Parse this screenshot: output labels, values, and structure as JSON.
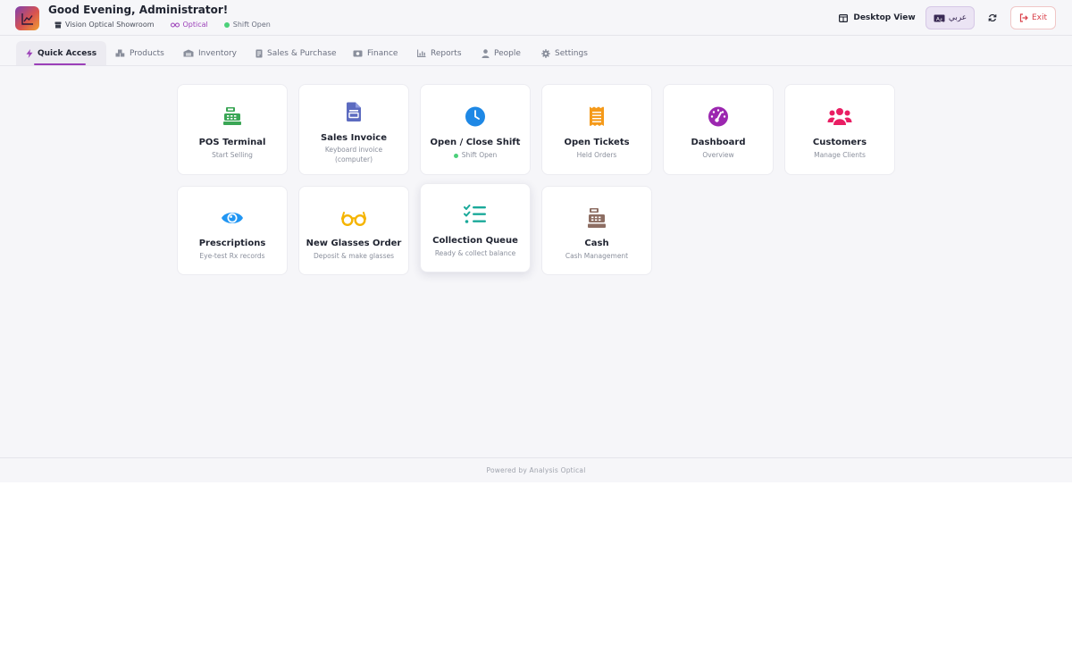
{
  "header": {
    "greeting": "Good Evening, Administrator!",
    "store": "Vision Optical Showroom",
    "mode": "Optical",
    "shift_status": "Shift Open",
    "desktop_view_label": "Desktop View",
    "language_label": "عربي",
    "exit_label": "Exit"
  },
  "tabs": [
    {
      "label": "Quick Access",
      "icon": "lightning-icon",
      "active": true
    },
    {
      "label": "Products",
      "icon": "boxes-icon"
    },
    {
      "label": "Inventory",
      "icon": "warehouse-icon"
    },
    {
      "label": "Sales & Purchase",
      "icon": "receipt-icon"
    },
    {
      "label": "Finance",
      "icon": "money-icon"
    },
    {
      "label": "Reports",
      "icon": "chart-icon"
    },
    {
      "label": "People",
      "icon": "person-icon"
    },
    {
      "label": "Settings",
      "icon": "gear-icon"
    }
  ],
  "cards": [
    {
      "title": "POS Terminal",
      "sub": "Start Selling",
      "icon": "cash-register-icon",
      "color": "#3aa655"
    },
    {
      "title": "Sales Invoice",
      "sub": "Keyboard invoice (computer)",
      "icon": "invoice-icon",
      "color": "#5c6bc0"
    },
    {
      "title": "Open / Close Shift",
      "sub": "Shift Open",
      "icon": "clock-icon",
      "color": "#1e88e5"
    },
    {
      "title": "Open Tickets",
      "sub": "Held Orders",
      "icon": "ticket-icon",
      "color": "#f59a1a"
    },
    {
      "title": "Dashboard",
      "sub": "Overview",
      "icon": "gauge-icon",
      "color": "#9c27b0"
    },
    {
      "title": "Customers",
      "sub": "Manage Clients",
      "icon": "users-icon",
      "color": "#e91e63"
    },
    {
      "title": "Prescriptions",
      "sub": "Eye-test Rx records",
      "icon": "eye-icon",
      "color": "#2196f3"
    },
    {
      "title": "New Glasses Order",
      "sub": "Deposit & make glasses",
      "icon": "glasses-icon",
      "color": "#f5b400"
    },
    {
      "title": "Collection Queue",
      "sub": "Ready & collect balance",
      "icon": "checklist-icon",
      "color": "#1aa99a"
    },
    {
      "title": "Cash",
      "sub": "Cash Management",
      "icon": "register-icon",
      "color": "#8d6e63"
    }
  ],
  "footer": {
    "text": "Powered by Analysis Optical"
  }
}
